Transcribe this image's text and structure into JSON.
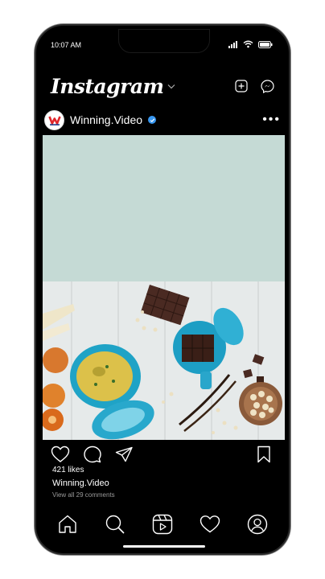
{
  "status": {
    "time": "10:07 AM",
    "icons": [
      "signal-icon",
      "wifi-icon",
      "battery-icon"
    ]
  },
  "header": {
    "app_name": "Instagram",
    "icons": [
      "chevron-down-icon",
      "new-post-icon",
      "messenger-icon"
    ]
  },
  "post": {
    "username": "Winning.Video",
    "avatar_letter": "W",
    "verified": true,
    "more_label": "•••",
    "likes": "421 likes",
    "caption_user": "Winning.Video",
    "comments_link": "View all 29 comments"
  },
  "actions": [
    "heart-icon",
    "comment-icon",
    "share-icon",
    "bookmark-icon"
  ],
  "nav": [
    "home-icon",
    "search-icon",
    "reels-icon",
    "activity-icon",
    "profile-icon"
  ],
  "colors": {
    "background": "#000000",
    "text": "#ffffff",
    "muted": "#9a9a9a",
    "media_placeholder": "#c5dad5",
    "verified": "#3897f0",
    "brand_red": "#e0262b",
    "brand_blue": "#1e3a8a"
  }
}
